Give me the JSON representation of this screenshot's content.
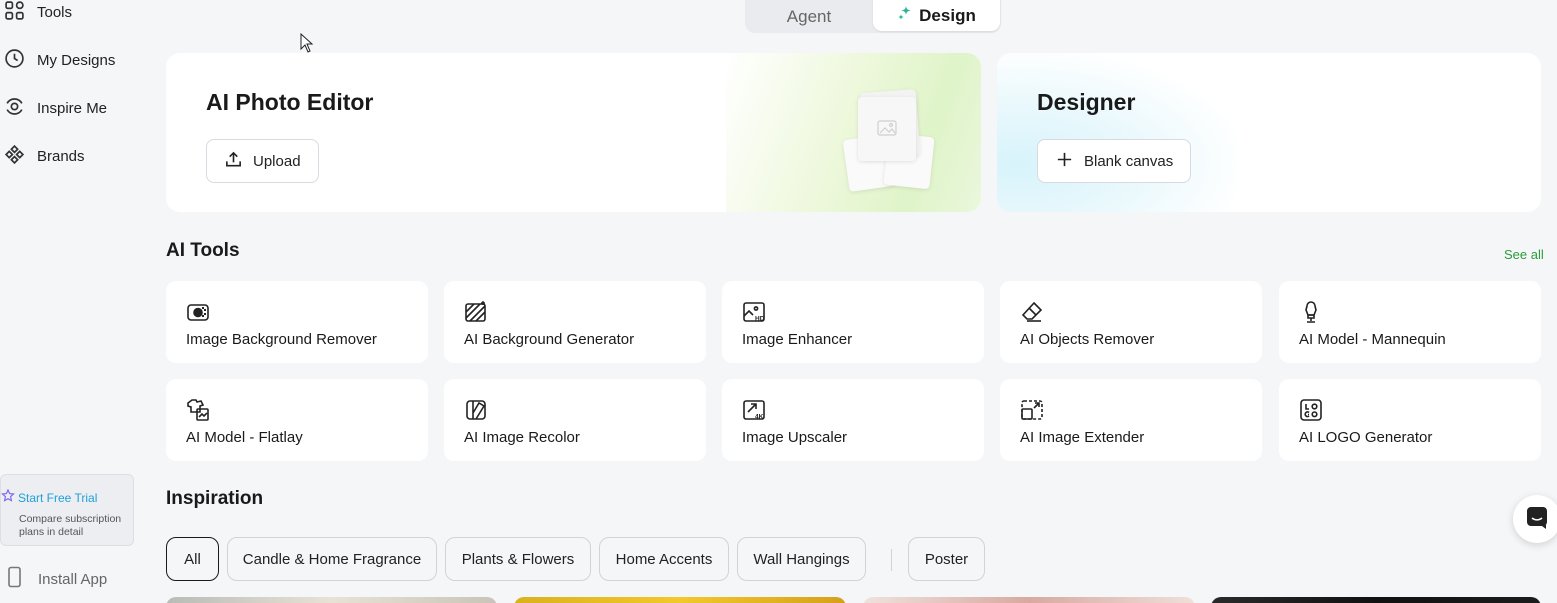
{
  "sidebar": {
    "items": [
      {
        "label": "Tools",
        "icon": "grid-icon"
      },
      {
        "label": "My Designs",
        "icon": "clock-icon"
      },
      {
        "label": "Inspire Me",
        "icon": "inspire-icon"
      },
      {
        "label": "Brands",
        "icon": "brands-icon"
      }
    ],
    "trial": {
      "title": "Start Free Trial",
      "subtitle": "Compare subscription plans in detail"
    },
    "install_label": "Install App"
  },
  "mode": {
    "agent_label": "Agent",
    "design_label": "Design",
    "active": "Design"
  },
  "photo_editor": {
    "title": "AI Photo Editor",
    "button": "Upload"
  },
  "designer": {
    "title": "Designer",
    "button": "Blank canvas"
  },
  "ai_tools": {
    "title": "AI Tools",
    "see_all": "See all",
    "items": [
      {
        "label": "Image Background Remover",
        "icon": "bg-remover-icon"
      },
      {
        "label": "AI Background Generator",
        "icon": "bg-generator-icon"
      },
      {
        "label": "Image Enhancer",
        "icon": "hd-enhancer-icon"
      },
      {
        "label": "AI Objects Remover",
        "icon": "eraser-icon"
      },
      {
        "label": "AI Model - Mannequin",
        "icon": "mannequin-icon"
      },
      {
        "label": "AI Model - Flatlay",
        "icon": "flatlay-icon"
      },
      {
        "label": "AI Image Recolor",
        "icon": "recolor-icon"
      },
      {
        "label": "Image Upscaler",
        "icon": "upscaler-4k-icon"
      },
      {
        "label": "AI Image Extender",
        "icon": "extender-icon"
      },
      {
        "label": "AI LOGO Generator",
        "icon": "logo-generator-icon"
      }
    ]
  },
  "inspiration": {
    "title": "Inspiration",
    "chips": [
      "All",
      "Candle & Home Fragrance",
      "Plants & Flowers",
      "Home Accents",
      "Wall Hangings",
      "Poster"
    ],
    "active_chip": "All"
  },
  "colors": {
    "accent_green": "#2b9a3c",
    "trial_blue": "#1fa0d8",
    "background": "#f5f6f8"
  }
}
